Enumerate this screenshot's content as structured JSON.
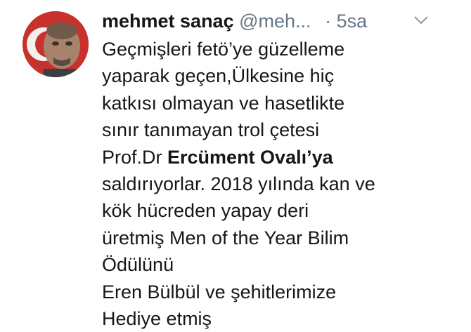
{
  "tweet": {
    "author": {
      "display_name": "mehmet sanaç",
      "handle": "@meh...",
      "avatar_icon": "user-avatar-photo"
    },
    "separator": "·",
    "timestamp": "5sa",
    "menu_icon": "chevron-down-icon",
    "lines": [
      "Geçmişleri fetö’ye güzelleme",
      "yaparak geçen,Ülkesine hiç",
      "katkısı olmayan ve hasetlikte",
      "sınır tanımayan trol çetesi"
    ],
    "line5_prefix": "Prof.Dr ",
    "line5_bold": "Ercüment Ovalı’ya",
    "lines_after": [
      "saldırıyorlar. 2018 yılında kan ve",
      "kök hücreden yapay deri",
      "üretmiş Men of the Year Bilim",
      "Ödülünü",
      "Eren Bülbül ve şehitlerimize",
      "Hediye etmiş"
    ],
    "colors": {
      "text": "#14171a",
      "secondary": "#657786",
      "avatar_flag_red": "#c9302c"
    }
  }
}
